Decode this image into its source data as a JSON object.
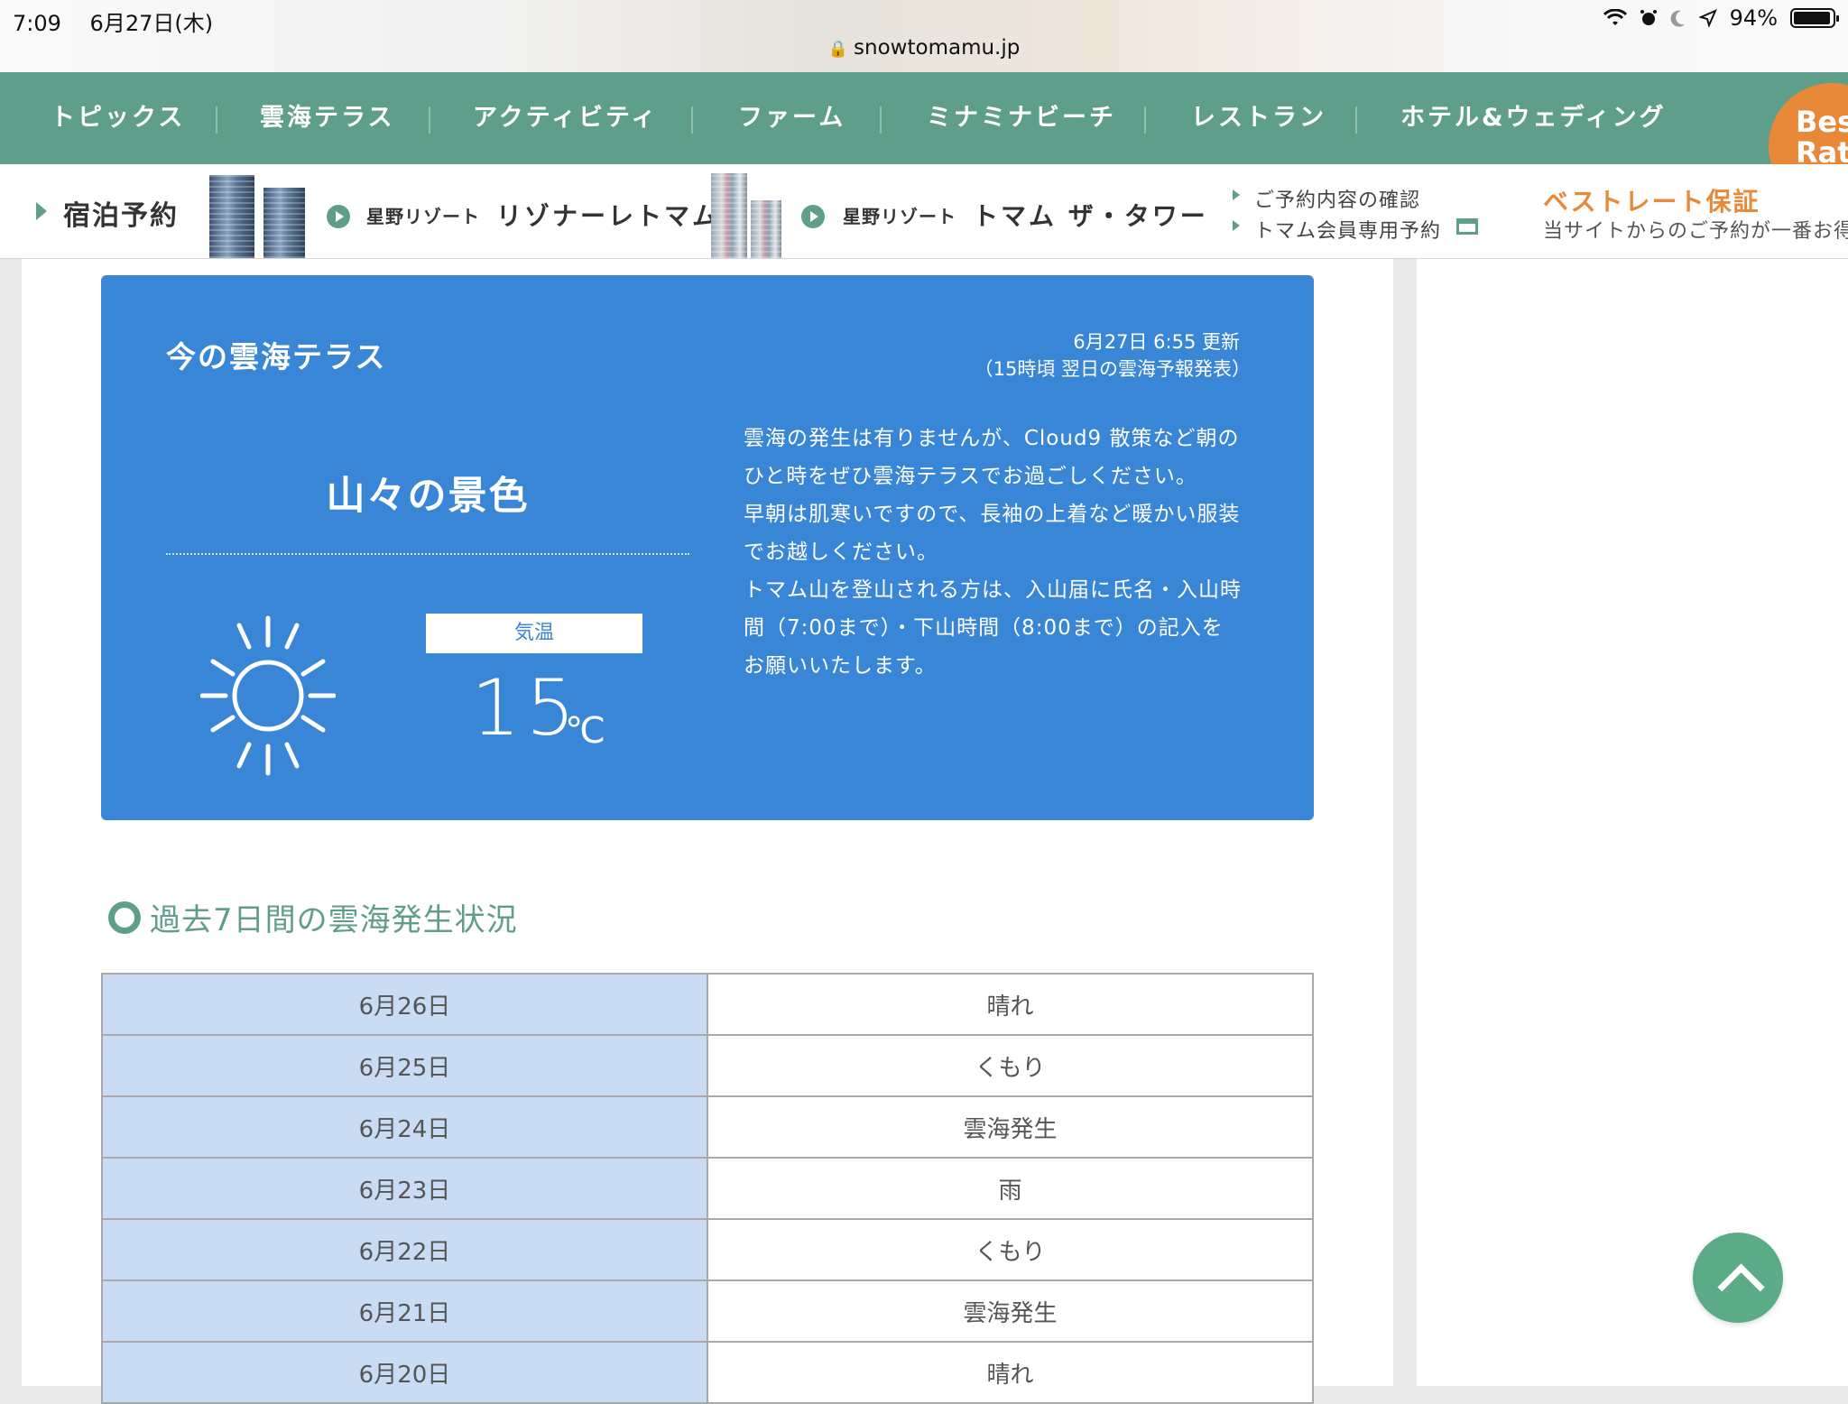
{
  "status_bar": {
    "time": "7:09",
    "date": "6月27日(木)",
    "battery": "94%"
  },
  "browser": {
    "url": "snowtomamu.jp"
  },
  "main_nav": [
    "トピックス",
    "雲海テラス",
    "アクティビティ",
    "ファーム",
    "ミナミナビーチ",
    "レストラン",
    "ホテル&ウェディング"
  ],
  "badge": {
    "line1": "Bes",
    "line2": "Rat"
  },
  "booking": {
    "label": "宿泊予約",
    "hotel1": {
      "brand": "星野リゾート",
      "name": "リゾナーレトマム"
    },
    "hotel2": {
      "brand": "星野リゾート",
      "name": "トマム ザ・タワー"
    },
    "links": [
      "ご予約内容の確認",
      "トマム会員専用予約"
    ],
    "best_rate_title": "ベストレート保証",
    "best_rate_sub": "当サイトからのご予約が一番お得で"
  },
  "weather": {
    "title": "今の雲海テラス",
    "updated": "6月27日 6:55 更新",
    "note": "（15時頃 翌日の雲海予報発表）",
    "condition": "山々の景色",
    "icon": "sun-icon",
    "temp_label": "気温",
    "temp_value": "15",
    "temp_unit": "℃",
    "description": [
      "雲海の発生は有りませんが、Cloud9 散策など朝の",
      "ひと時をぜひ雲海テラスでお過ごしください。",
      "早朝は肌寒いですので、長袖の上着など暖かい服装",
      "でお越しください。",
      "トマム山を登山される方は、入山届に氏名・入山時",
      "間（7:00まで）・下山時間（8:00まで）の記入を",
      "お願いいたします。"
    ]
  },
  "history": {
    "title": "過去7日間の雲海発生状況",
    "rows": [
      {
        "date": "6月26日",
        "status": "晴れ"
      },
      {
        "date": "6月25日",
        "status": "くもり"
      },
      {
        "date": "6月24日",
        "status": "雲海発生"
      },
      {
        "date": "6月23日",
        "status": "雨"
      },
      {
        "date": "6月22日",
        "status": "くもり"
      },
      {
        "date": "6月21日",
        "status": "雲海発生"
      },
      {
        "date": "6月20日",
        "status": "晴れ"
      }
    ]
  },
  "colors": {
    "nav_green": "#5f9e8a",
    "weather_blue": "#3a86d6",
    "accent_orange": "#e8893a",
    "table_date_bg": "#c9dcf3"
  }
}
